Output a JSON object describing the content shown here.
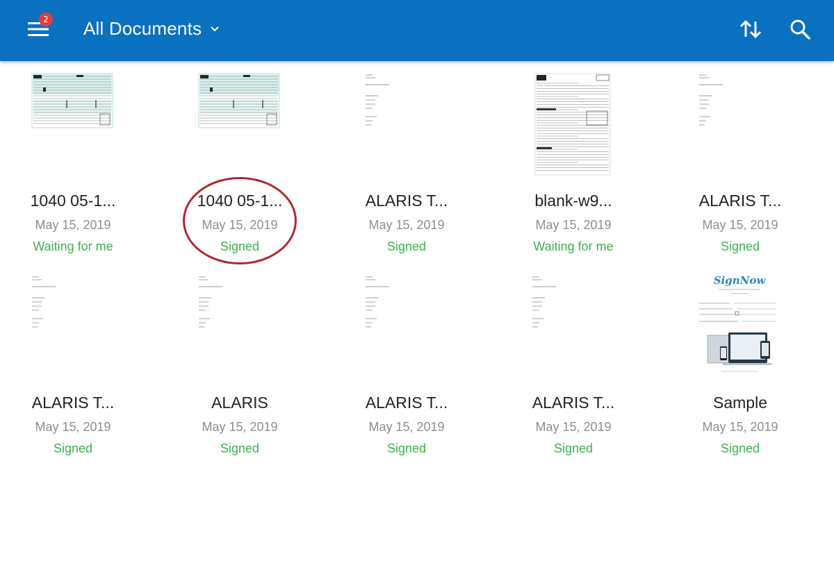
{
  "appbar": {
    "title": "All Documents",
    "badge_count": "2",
    "icons": {
      "menu": "menu-icon",
      "dropdown": "chevron-down-icon",
      "sort": "sort-icon",
      "search": "search-icon"
    },
    "color": "#0a71c0"
  },
  "documents": [
    {
      "name": "1040 05-1...",
      "date": "May 15, 2019",
      "status": "Waiting for me",
      "thumb": "form-1040"
    },
    {
      "name": "1040 05-1...",
      "date": "May 15, 2019",
      "status": "Signed",
      "thumb": "form-1040"
    },
    {
      "name": "ALARIS T...",
      "date": "May 15, 2019",
      "status": "Signed",
      "thumb": "text-page"
    },
    {
      "name": "blank-w9...",
      "date": "May 15, 2019",
      "status": "Waiting for me",
      "thumb": "form-w9"
    },
    {
      "name": "ALARIS T...",
      "date": "May 15, 2019",
      "status": "Signed",
      "thumb": "text-page"
    },
    {
      "name": "ALARIS T...",
      "date": "May 15, 2019",
      "status": "Signed",
      "thumb": "text-page"
    },
    {
      "name": "ALARIS",
      "date": "May 15, 2019",
      "status": "Signed",
      "thumb": "text-page"
    },
    {
      "name": "ALARIS T...",
      "date": "May 15, 2019",
      "status": "Signed",
      "thumb": "text-page"
    },
    {
      "name": "ALARIS T...",
      "date": "May 15, 2019",
      "status": "Signed",
      "thumb": "text-page"
    },
    {
      "name": "Sample",
      "date": "May 15, 2019",
      "status": "Signed",
      "thumb": "signnow-sample"
    }
  ],
  "sample_thumb": {
    "logo": "SignNow"
  },
  "status_color": "#3cb34a"
}
